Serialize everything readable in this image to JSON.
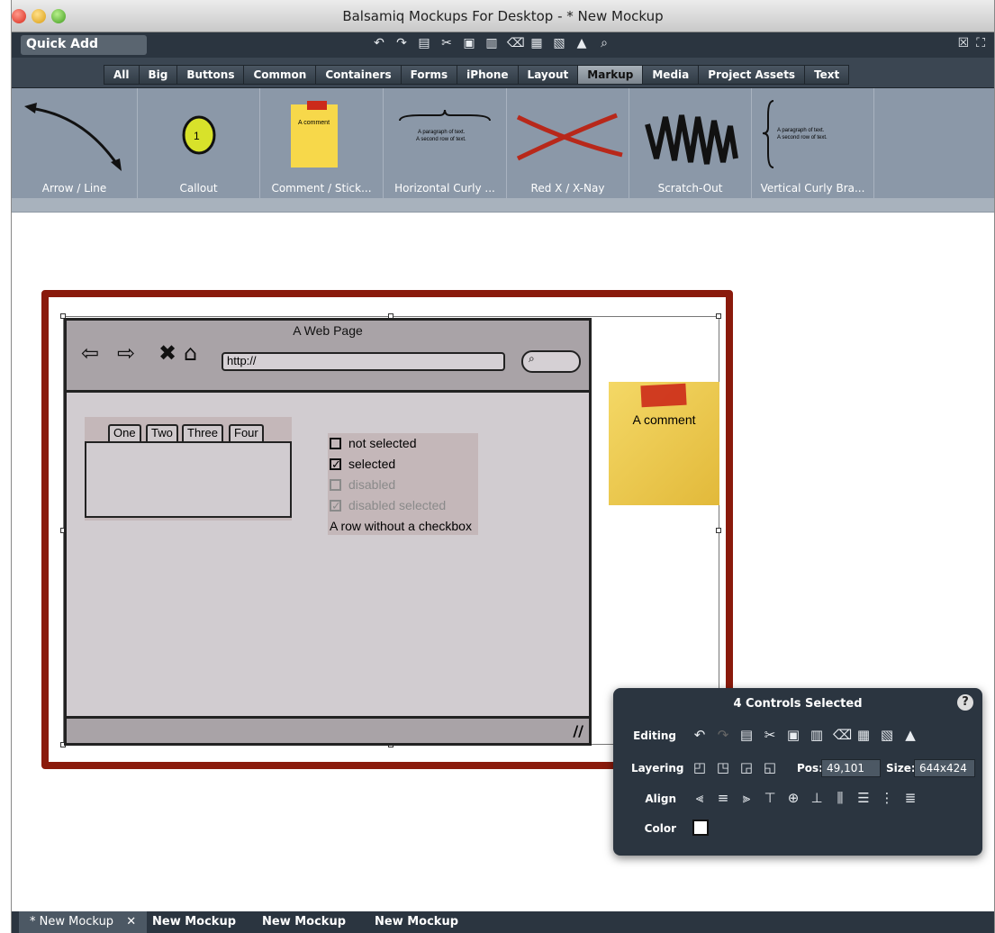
{
  "window": {
    "title": "Balsamiq Mockups For Desktop - * New Mockup"
  },
  "toolbar": {
    "quick_add": "Quick Add",
    "icons": [
      "undo-icon",
      "redo-icon",
      "copy-icon",
      "cut-icon",
      "paste-icon",
      "duplicate-icon",
      "delete-icon",
      "group-icon",
      "ungroup-icon",
      "lock-icon",
      "search-icon"
    ],
    "right_icons": [
      "close-icon",
      "fullscreen-icon"
    ]
  },
  "library_tabs": [
    "All",
    "Big",
    "Buttons",
    "Common",
    "Containers",
    "Forms",
    "iPhone",
    "Layout",
    "Markup",
    "Media",
    "Project Assets",
    "Text"
  ],
  "active_library_tab": "Markup",
  "shelf_items": [
    "Arrow / Line",
    "Callout",
    "Comment / Stick...",
    "Horizontal Curly ...",
    "Red X / X-Nay",
    "Scratch-Out",
    "Vertical Curly Bra..."
  ],
  "shelf_previews": {
    "callout_number": "1",
    "comment_text": "A comment",
    "curly_text_1": "A paragraph of text.",
    "curly_text_2": "A second row of text."
  },
  "mockup": {
    "browser_title": "A Web Page",
    "url": "http://",
    "tabs": [
      "One",
      "Two",
      "Three",
      "Four"
    ],
    "checkboxes": [
      {
        "label": "not selected",
        "checked": false,
        "disabled": false
      },
      {
        "label": "selected",
        "checked": true,
        "disabled": false
      },
      {
        "label": "disabled",
        "checked": false,
        "disabled": true
      },
      {
        "label": "disabled selected",
        "checked": true,
        "disabled": true
      }
    ],
    "row_without_checkbox": "A row without a checkbox",
    "sticky_text": "A comment"
  },
  "inspector": {
    "title": "4 Controls Selected",
    "help": "?",
    "editing_label": "Editing",
    "layering_label": "Layering",
    "align_label": "Align",
    "color_label": "Color",
    "pos_label": "Pos:",
    "pos_value": "49,101",
    "size_label": "Size:",
    "size_value": "644x424"
  },
  "bottom_tabs": [
    "* New Mockup",
    "New Mockup",
    "New Mockup",
    "New Mockup"
  ],
  "colors": {
    "red_outline": "#8a1a0c",
    "toolbar_bg": "#2b3540"
  }
}
